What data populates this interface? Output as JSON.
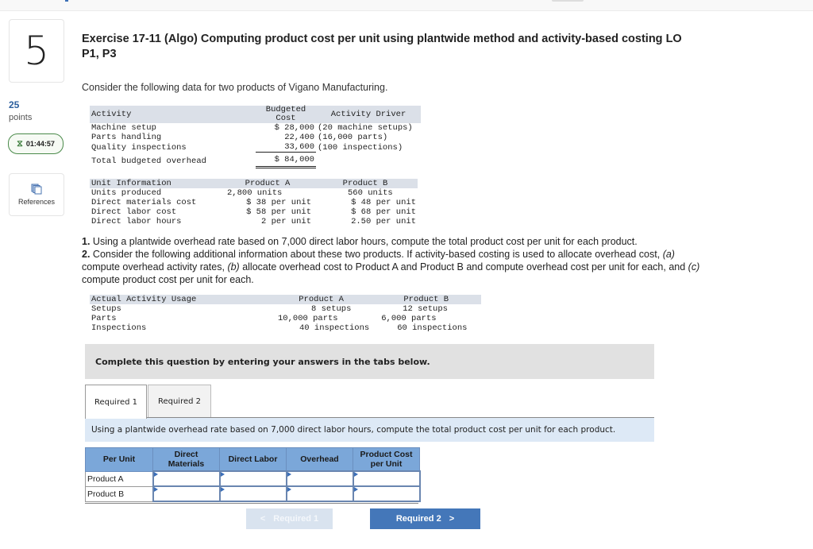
{
  "sidebar": {
    "question_number": "5",
    "points_value": "25",
    "points_label": "points",
    "timer": "01:44:57",
    "timer_icon": "hourglass-icon",
    "references_label": "References",
    "references_icon": "stacked-pages-icon"
  },
  "header": {
    "title": "Exercise 17-11 (Algo) Computing product cost per unit using plantwide method and activity-based costing LO P1, P3",
    "intro": "Consider the following data for two products of Vigano Manufacturing."
  },
  "activity_table": {
    "headers": [
      "Activity",
      "Budgeted\nCost",
      "Activity Driver"
    ],
    "rows": [
      {
        "activity": "Machine setup",
        "cost": "$ 28,000",
        "driver": "(20 machine setups)"
      },
      {
        "activity": "Parts handling",
        "cost": "22,400",
        "driver": "(16,000 parts)"
      },
      {
        "activity": "Quality inspections",
        "cost": "33,600",
        "driver": "(100 inspections)"
      }
    ],
    "total": {
      "activity": "Total budgeted overhead",
      "cost": "$ 84,000"
    }
  },
  "unit_table": {
    "headers": [
      "Unit Information",
      "Product A",
      "Product B"
    ],
    "rows": [
      {
        "label": "Units produced",
        "a": "2,800 units",
        "b": "560 units"
      },
      {
        "label": "Direct materials cost",
        "a": "$ 38 per unit",
        "b": "$ 48 per unit"
      },
      {
        "label": "Direct labor cost",
        "a": "$ 58 per unit",
        "b": "$ 68 per unit"
      },
      {
        "label": "Direct labor hours",
        "a": "2 per unit",
        "b": "2.50 per unit"
      }
    ]
  },
  "requirements": {
    "r1_num": "1.",
    "r1_text": " Using a plantwide overhead rate based on 7,000 direct labor hours, compute the total product cost per unit for each product.",
    "r2_num": "2.",
    "r2_text": " Consider the following additional information about these two products. If activity-based costing is used to allocate overhead cost, ",
    "r2_a": "(a)",
    "r2_a_text": " compute overhead activity rates, ",
    "r2_b": "(b)",
    "r2_b_text": " allocate overhead cost to Product A and Product B and compute overhead cost per unit for each, and ",
    "r2_c": "(c)",
    "r2_c_text": " compute product cost per unit for each."
  },
  "usage_table": {
    "headers": [
      "Actual Activity Usage",
      "Product A",
      "Product B"
    ],
    "rows": [
      {
        "label": "Setups",
        "a": "8 setups",
        "b": "12 setups"
      },
      {
        "label": "Parts",
        "a": "10,000 parts",
        "b": "6,000 parts"
      },
      {
        "label": "Inspections",
        "a": "40 inspections",
        "b": "60 inspections"
      }
    ]
  },
  "answer_area": {
    "banner": "Complete this question by entering your answers in the tabs below.",
    "tabs": [
      {
        "label": "Required 1",
        "active": true
      },
      {
        "label": "Required 2",
        "active": false
      }
    ],
    "instruction": "Using a plantwide overhead rate based on 7,000 direct labor hours, compute the total product cost per unit for each product.",
    "table": {
      "headers": [
        "Per Unit",
        "Direct Materials",
        "Direct Labor",
        "Overhead",
        "Product Cost per Unit"
      ],
      "rows": [
        {
          "label": "Product A",
          "values": [
            "",
            "",
            "",
            ""
          ]
        },
        {
          "label": "Product B",
          "values": [
            "",
            "",
            "",
            ""
          ]
        }
      ]
    },
    "nav": {
      "prev_label": "Required 1",
      "prev_icon": "chevron-left-icon",
      "next_label": "Required 2",
      "next_icon": "chevron-right-icon"
    }
  },
  "colors": {
    "accent_blue": "#4477b9",
    "table_header_blue": "#7ba7d9",
    "timer_green": "#4a8a4a",
    "instruction_bg": "#dde9f6"
  }
}
